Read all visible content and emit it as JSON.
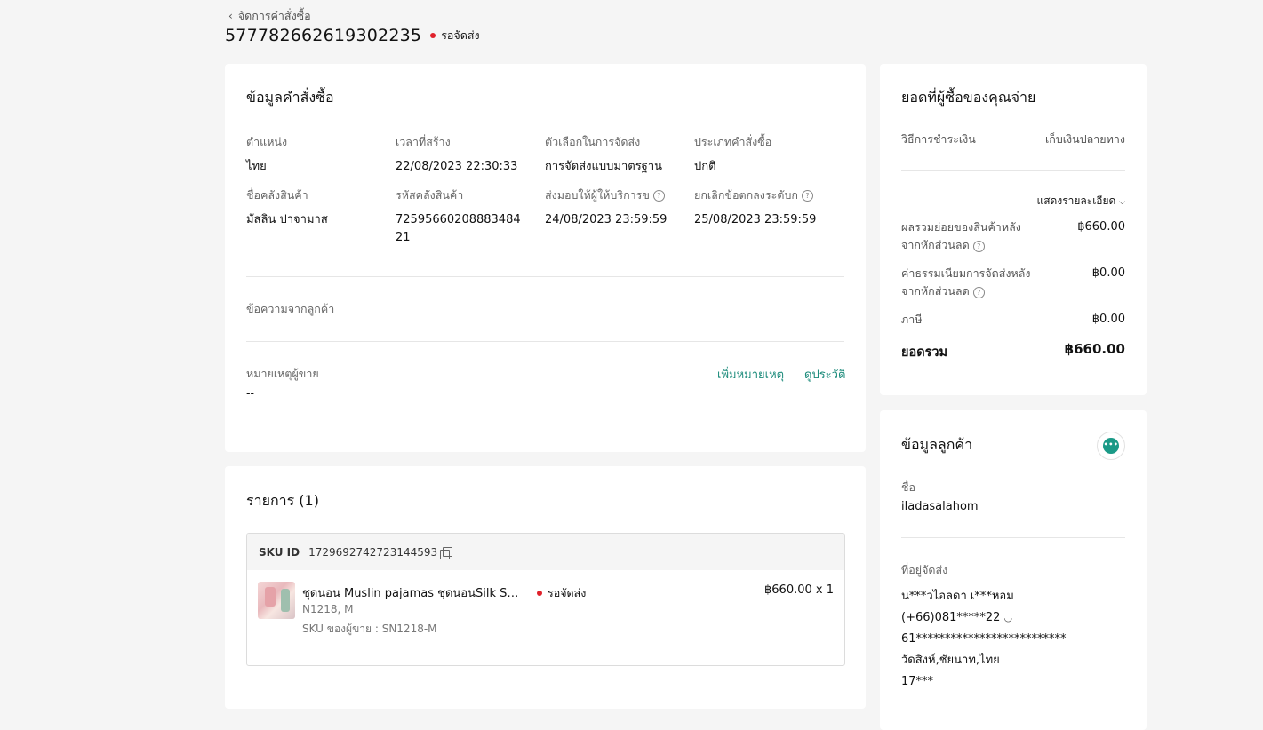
{
  "breadcrumb": {
    "back_label": "จัดการคำสั่งซื้อ"
  },
  "order": {
    "id": "577782662619302235",
    "status": "รอจัดส่ง"
  },
  "order_info": {
    "title": "ข้อมูลคำสั่งซื้อ",
    "fields": [
      {
        "label": "ตำแหน่ง",
        "value": "ไทย"
      },
      {
        "label": "เวลาที่สร้าง",
        "value": "22/08/2023 22:30:33"
      },
      {
        "label": "ตัวเลือกในการจัดส่ง",
        "value": "การจัดส่งแบบมาตรฐาน"
      },
      {
        "label": "ประเภทคำสั่งซื้อ",
        "value": "ปกติ"
      },
      {
        "label": "ชื่อคลังสินค้า",
        "value": "มัสลิน ปาจามาส"
      },
      {
        "label": "รหัสคลังสินค้า",
        "value": "7259566020888348421"
      },
      {
        "label": "ส่งมอบให้ผู้ให้บริการข",
        "value": "24/08/2023 23:59:59"
      },
      {
        "label": "ยกเลิกข้อตกลงระดับก",
        "value": "25/08/2023 23:59:59"
      }
    ],
    "customer_message_label": "ข้อความจากลูกค้า",
    "seller_note_label": "หมายเหตุผู้ขาย",
    "seller_note_value": "--",
    "add_note": "เพิ่มหมายเหตุ",
    "view_history": "ดูประวัติ"
  },
  "items": {
    "title": "รายการ (1)",
    "sku_id_label": "SKU ID",
    "sku_id": "1729692742723144593",
    "product_name": "ชุดนอน Muslin pajamas ชุดนอนSilk Satin",
    "variant": "N1218, M",
    "seller_sku": "SKU ของผู้ขาย : SN1218-M",
    "status": "รอจัดส่ง",
    "price_qty": "฿660.00 x 1"
  },
  "payment": {
    "title": "ยอดที่ผู้ซื้อของคุณจ่าย",
    "method_label": "วิธีการชำระเงิน",
    "method_value": "เก็บเงินปลายทาง",
    "detail_toggle": "แสดงรายละเอียด",
    "subtotal_label_1": "ผลรวมย่อยของสินค้าหลัง",
    "subtotal_label_2": "จากหักส่วนลด",
    "subtotal_value": "฿660.00",
    "shipping_label_1": "ค่าธรรมเนียมการจัดส่งหลัง",
    "shipping_label_2": "จากหักส่วนลด",
    "shipping_value": "฿0.00",
    "tax_label": "ภาษี",
    "tax_value": "฿0.00",
    "total_label": "ยอดรวม",
    "total_value": "฿660.00"
  },
  "customer": {
    "title": "ข้อมูลลูกค้า",
    "name_label": "ชื่อ",
    "name_value": "iladasalahom",
    "address_label": "ที่อยู่จัดส่ง",
    "address_lines": [
      "น***วไอลดา เ***หอม",
      "(+66)081*****22",
      "61**************************",
      "วัดสิงห์,ชัยนาท,ไทย",
      "17***"
    ]
  },
  "colors": {
    "accent": "#1a8a7a",
    "status_dot": "#e0212b",
    "background": "#f5f5f5"
  }
}
